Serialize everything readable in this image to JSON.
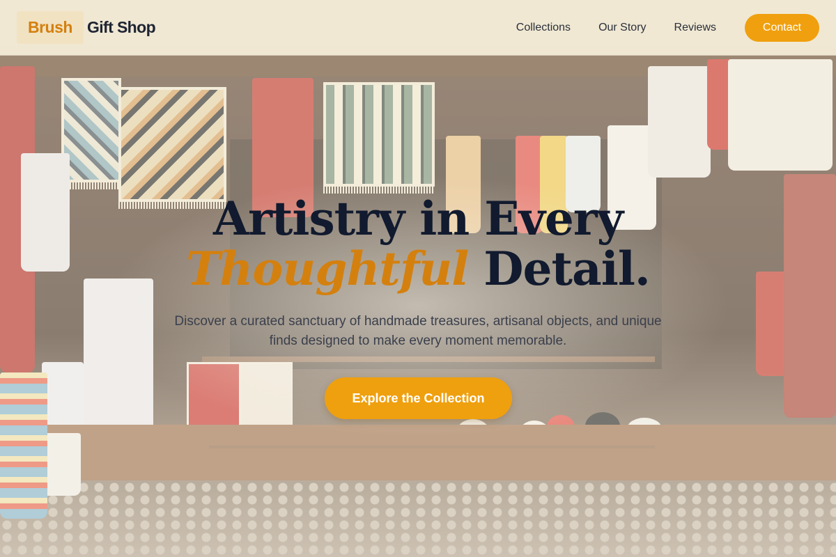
{
  "brand": {
    "mark": "Brush",
    "name": "Gift Shop"
  },
  "nav": {
    "links": [
      "Collections",
      "Our Story",
      "Reviews"
    ],
    "contact_label": "Contact"
  },
  "hero": {
    "title_line1": "Artistry in Every",
    "title_accent": "Thoughtful",
    "title_line2_rest": " Detail.",
    "subtitle": "Discover a curated sanctuary of handmade treasures, artisanal objects, and unique finds designed to make every moment memorable.",
    "cta_label": "Explore the Collection"
  },
  "colors": {
    "accent": "#f0a00e",
    "accent_text": "#d4800f",
    "heading": "#111a2e",
    "header_bg": "#f6efda"
  }
}
